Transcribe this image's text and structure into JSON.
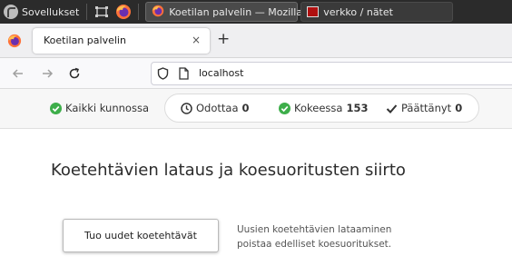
{
  "taskbar": {
    "start_label": "Sovellukset",
    "windows": [
      {
        "title": "Koetilan palvelin — Mozilla ..."
      },
      {
        "title": "verkko / nätet"
      }
    ]
  },
  "browser": {
    "tab_title": "Koetilan palvelin",
    "tab_close": "×",
    "new_tab": "+",
    "url": "localhost"
  },
  "status": {
    "ok_label": "Kaikki kunnossa",
    "waiting_label": "Odottaa",
    "waiting_count": "0",
    "in_exam_label": "Kokeessa",
    "in_exam_count": "153",
    "finished_label": "Päättänyt",
    "finished_count": "0"
  },
  "main": {
    "title": "Koetehtävien lataus ja koesuoritusten siirto",
    "import_button": "Tuo uudet koetehtävät",
    "help_line1": "Uusien koetehtävien lataaminen",
    "help_line2": "poistaa edelliset koesuoritukset."
  },
  "colors": {
    "taskbar_bg": "#2b2b2b",
    "ok_green": "#3dae4a",
    "terminal_red": "#b01010"
  }
}
